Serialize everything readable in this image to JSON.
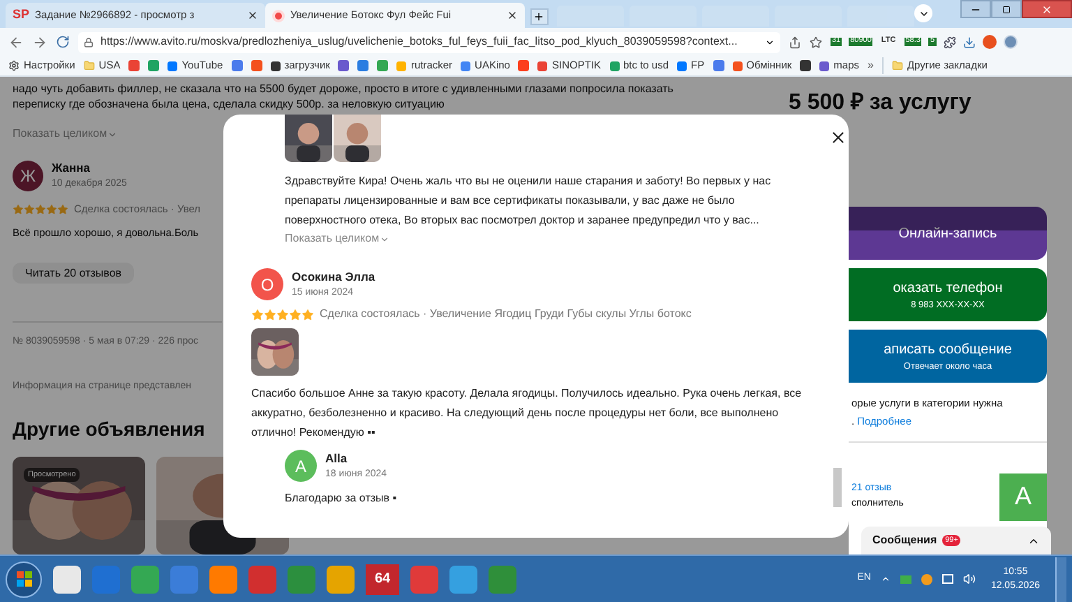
{
  "browser": {
    "tabs": [
      {
        "favicon": "SP",
        "title": "Задание №2966892 - просмотр з",
        "selected": false
      },
      {
        "title": "Увеличение Ботокс Фул Фейс Fui",
        "selected": true
      }
    ],
    "url": "https://www.avito.ru/moskva/predlozheniya_uslug/uvelichenie_botoks_ful_feys_fuii_fac_litso_pod_klyuch_8039059598?context...",
    "extension_badges": [
      "31",
      "80900",
      "LTC",
      "58.3",
      "5"
    ],
    "bookmarks": [
      {
        "kind": "labeled",
        "label": "Настройки"
      },
      {
        "kind": "labeled",
        "label": "USA"
      },
      {
        "kind": "icon"
      },
      {
        "kind": "icon"
      },
      {
        "kind": "labeled",
        "label": "YouTube"
      },
      {
        "kind": "icon"
      },
      {
        "kind": "icon"
      },
      {
        "kind": "labeled",
        "label": "загрузчик"
      },
      {
        "kind": "icon"
      },
      {
        "kind": "icon"
      },
      {
        "kind": "icon"
      },
      {
        "kind": "labeled",
        "label": "rutracker"
      },
      {
        "kind": "labeled",
        "label": "UAKino"
      },
      {
        "kind": "icon"
      },
      {
        "kind": "labeled",
        "label": "SINOPTIK"
      },
      {
        "kind": "labeled",
        "label": "btc to usd"
      },
      {
        "kind": "labeled",
        "label": "FP"
      },
      {
        "kind": "icon"
      },
      {
        "kind": "labeled",
        "label": "Обмінник"
      },
      {
        "kind": "icon"
      },
      {
        "kind": "labeled",
        "label": "maps"
      },
      {
        "kind": "more",
        "label": "»"
      },
      {
        "kind": "folder",
        "label": "Другие закладки"
      }
    ]
  },
  "listing": {
    "review_text": [
      "надо чуть добавить филлер, не сказала что на 5500 будет дороже, просто в итоге с удивленными глазами попросила показать",
      "переписку где обозначена была цена, сделала скидку 500р. за неловкую ситуацию"
    ],
    "show_more": "Показать целиком",
    "review": {
      "initial": "Ж",
      "name": "Жанна",
      "date": "10 декабря 2025",
      "stars": 5,
      "deal": "Сделка состоялась · Увел",
      "text": "Всё прошло хорошо, я довольна.Боль"
    },
    "read_all": "Читать 20 отзывов",
    "meta": "№ 8039059598 · 5 мая в 07:29 · 226 прос",
    "info": "Информация на странице представлен",
    "other_heading": "Другие объявления",
    "cards": [
      {
        "kind": "picture",
        "badge": "Просмотрено"
      },
      {
        "kind": "picture"
      }
    ]
  },
  "sidebar": {
    "price": "5 500 ₽ за услугу",
    "buttons": [
      {
        "label": "Онлайн-запись"
      },
      {
        "label": "оказать телефон",
        "sub": "8 983 XXX-XX-XX"
      },
      {
        "label": "аписать сообщение",
        "sub": "Отвечает около часа"
      }
    ],
    "note": "орые услуги в категории нужна",
    "note_end": ".",
    "link": "Подробнее",
    "seller": {
      "rating": "21 отзыв",
      "role": "сполнитель",
      "avatar": "A"
    },
    "messages": {
      "label": "Сообщения",
      "badge": "99+"
    }
  },
  "modal": {
    "reply": {
      "photos": [
        {
          "kind": "picture"
        },
        {
          "kind": "picture"
        }
      ],
      "text": "Здравствуйте Кира! Очень жаль что вы не оценили наше старания и заботу! Во первых у нас препараты лицензированные и вам все сертификаты показывали, у вас даже не было поверхностного отека, Во вторых вас посмотрел доктор и заранее предупредил что у вас...",
      "show_more": "Показать целиком"
    },
    "review": {
      "initial": "О",
      "color": "#f2544b",
      "name": "Осокина Элла",
      "date": "15 июня 2024",
      "stars": 5,
      "deal": "Сделка состоялась · Увеличение Ягодиц Груди Губы скулы Углы ботокс",
      "photos": [
        {
          "kind": "picture"
        }
      ],
      "text": "Спасибо большое Анне за такую красоту. Делала ягодицы. Получилось идеально. Рука очень легкая, все аккуратно, безболезненно и красиво. На следующий день после процедуры нет боли, все выполнено отлично! Рекомендую ▪▪",
      "reply": {
        "initial": "A",
        "color": "#5cbd5c",
        "name": "Alla",
        "date": "18 июня 2024",
        "text": "Благодарю за отзыв ▪"
      }
    }
  },
  "taskbar": {
    "tile": "64",
    "lang": "EN",
    "time": "10:55",
    "date": "12.05.2026"
  }
}
